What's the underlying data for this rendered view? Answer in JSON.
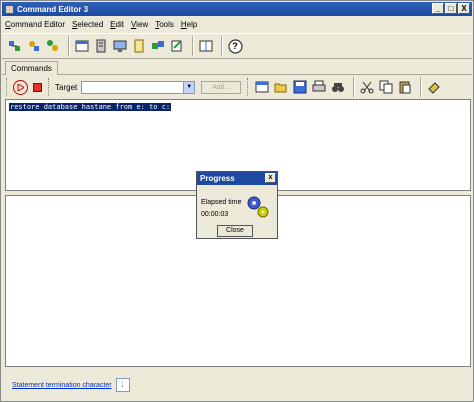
{
  "window": {
    "title": "Command Editor 3"
  },
  "window_controls": {
    "minimize": "_",
    "maximize": "□",
    "close": "X"
  },
  "menu": [
    "Command Editor",
    "Selected",
    "Edit",
    "View",
    "Tools",
    "Help"
  ],
  "toolbar1": {
    "icons": [
      "scripts-icon",
      "tools-icon",
      "settings-icon",
      "window-icon",
      "server-icon",
      "document-icon",
      "bundle-icon",
      "edit-icon",
      "chevron-icon",
      "split-icon",
      "help-icon"
    ],
    "help_label": "?"
  },
  "tabs": [
    {
      "label": "Commands"
    }
  ],
  "toolbar2": {
    "target_label": "Target",
    "target_value": "",
    "add_label": "Add...",
    "icons": [
      "run-icon",
      "stop-icon",
      "window-icon",
      "open-folder-icon",
      "save-icon",
      "print-icon",
      "binoculars-icon",
      "cut-icon",
      "copy-icon",
      "paste-icon",
      "eraser-icon"
    ]
  },
  "editor": {
    "text": "restore database hastane from e: to c:"
  },
  "statusbar": {
    "label": "Statement termination character",
    "value": ";"
  },
  "progress_dialog": {
    "title": "Progress",
    "close_x": "x",
    "elapsed_label": "Elapsed time",
    "elapsed_value": "00:00:03",
    "close_button": "Close"
  },
  "colors": {
    "titlebar": "#1d4aa0",
    "selection": "#0a246a",
    "link": "#0033cc"
  }
}
